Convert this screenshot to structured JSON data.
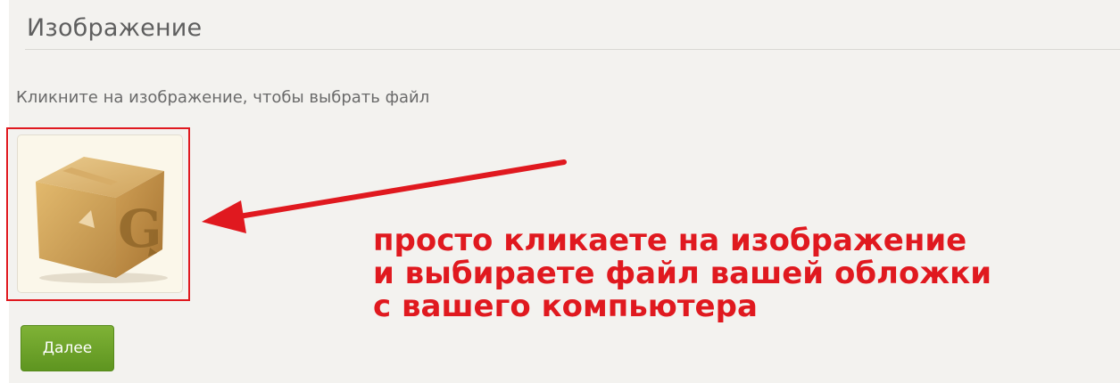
{
  "section": {
    "title": "Изображение"
  },
  "image_picker": {
    "hint": "Кликните на изображение, чтобы выбрать файл",
    "placeholder_icon": "cardboard-box-upload-icon"
  },
  "annotation": {
    "lines": [
      "просто кликаете на изображение",
      "и выбираете файл вашей обложки",
      "с вашего компьютера"
    ]
  },
  "actions": {
    "next_label": "Далее"
  },
  "colors": {
    "annotation_red": "#e0191f",
    "button_green": "#6ea22a",
    "panel_background": "#f3f2ef"
  }
}
